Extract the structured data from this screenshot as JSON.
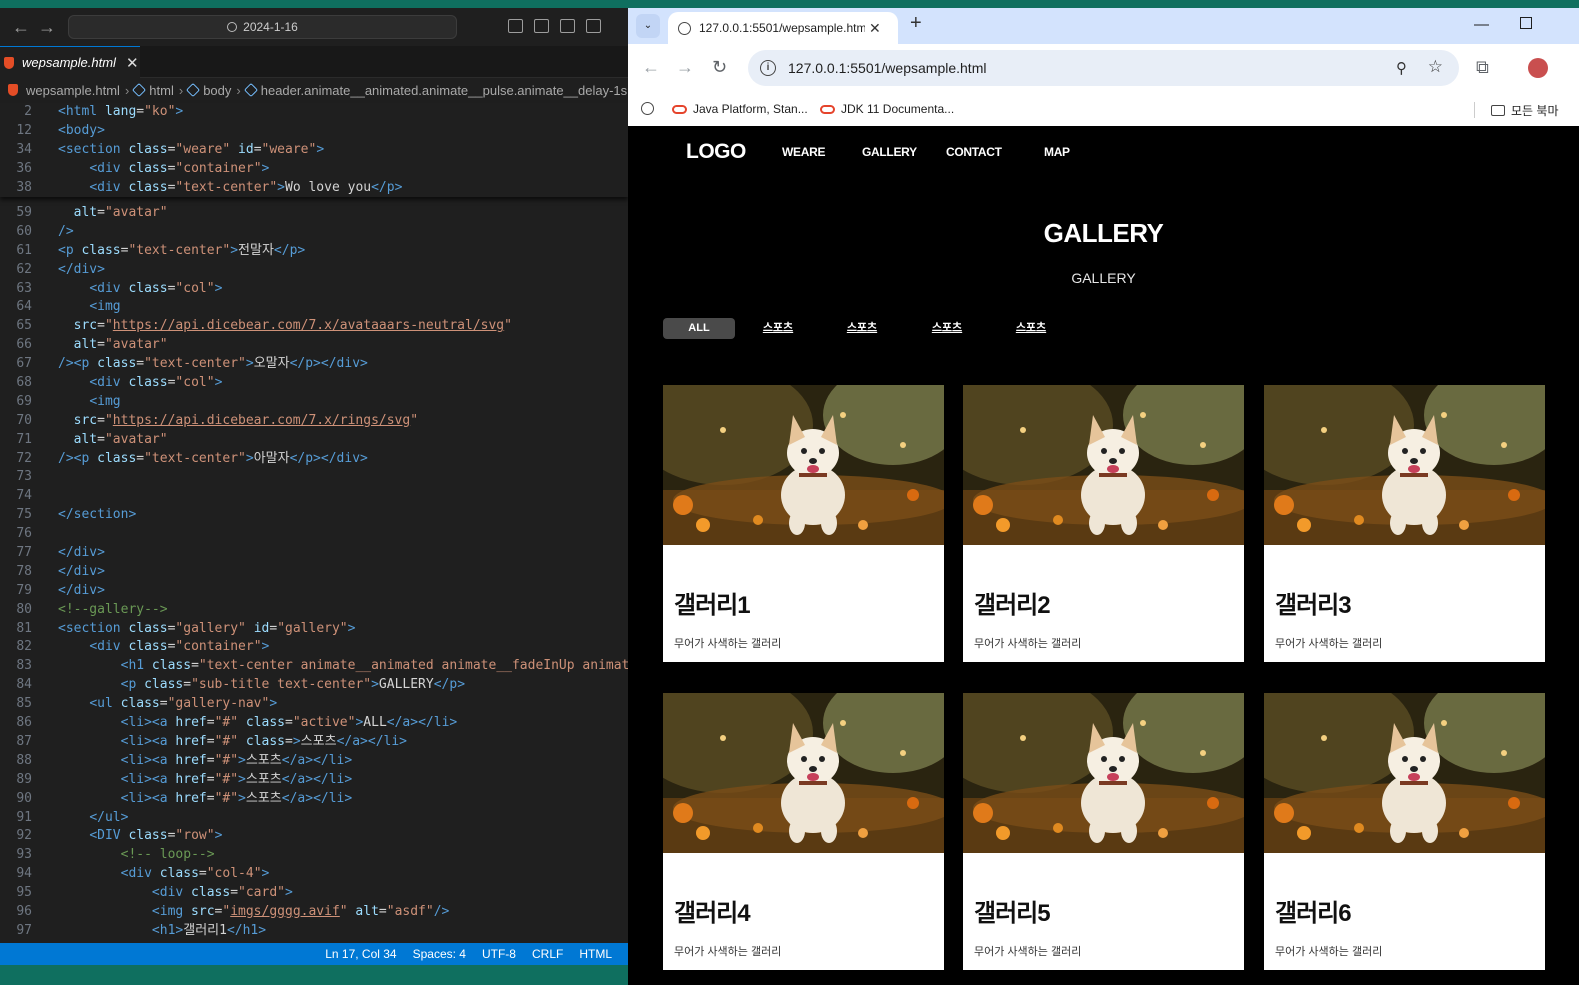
{
  "vscode": {
    "search_text": "2024-1-16",
    "tab_label": "wepsample.html",
    "breadcrumb": [
      "wepsample.html",
      "html",
      "body",
      "header.animate__animated.animate__pulse.animate__delay-1s"
    ],
    "status": {
      "position": "Ln 17, Col 34",
      "spaces": "Spaces: 4",
      "encoding": "UTF-8",
      "eol": "CRLF",
      "language": "HTML"
    }
  },
  "browser": {
    "tab_title": "127.0.0.1:5501/wepsample.htm",
    "url": "127.0.0.1:5501/wepsample.html",
    "bookmarks": [
      "Java Platform, Stan...",
      "JDK 11 Documenta..."
    ],
    "bookmarks_folder": "모든 북마"
  },
  "site": {
    "logo": "LOGO",
    "nav": [
      "WEARE",
      "GALLERY",
      "CONTACT",
      "MAP"
    ],
    "gallery_title": "GALLERY",
    "gallery_subtitle": "GALLERY",
    "filters": [
      "ALL",
      "스포츠",
      "스포츠",
      "스포츠",
      "스포츠"
    ],
    "cards": [
      {
        "title": "갤러리1",
        "desc": "무어가 사색하는 갤러리"
      },
      {
        "title": "갤러리2",
        "desc": "무어가 사색하는 갤러리"
      },
      {
        "title": "갤러리3",
        "desc": "무어가 사색하는 갤러리"
      },
      {
        "title": "갤러리4",
        "desc": "무어가 사색하는 갤러리"
      },
      {
        "title": "갤러리5",
        "desc": "무어가 사색하는 갤러리"
      },
      {
        "title": "갤러리6",
        "desc": "무어가 사색하는 갤러리"
      }
    ]
  },
  "code": {
    "sticky": [
      {
        "n": "2",
        "tokens": [
          [
            "t",
            "<html"
          ],
          [
            "a",
            " lang"
          ],
          [
            "w",
            "="
          ],
          [
            "s",
            "\"ko\""
          ],
          [
            "t",
            ">"
          ]
        ]
      },
      {
        "n": "12",
        "tokens": [
          [
            "t",
            "<body>"
          ]
        ]
      },
      {
        "n": "34",
        "tokens": [
          [
            "t",
            "<section"
          ],
          [
            "a",
            " class"
          ],
          [
            "w",
            "="
          ],
          [
            "s",
            "\"weare\""
          ],
          [
            "a",
            " id"
          ],
          [
            "w",
            "="
          ],
          [
            "s",
            "\"weare\""
          ],
          [
            "t",
            ">"
          ]
        ]
      },
      {
        "n": "36",
        "tokens": [
          [
            "w",
            "    "
          ],
          [
            "t",
            "<div"
          ],
          [
            "a",
            " class"
          ],
          [
            "w",
            "="
          ],
          [
            "s",
            "\"container\""
          ],
          [
            "t",
            ">"
          ]
        ]
      },
      {
        "n": "38",
        "tokens": [
          [
            "w",
            "    "
          ],
          [
            "t",
            "<div"
          ],
          [
            "a",
            " class"
          ],
          [
            "w",
            "="
          ],
          [
            "s",
            "\"text-center\""
          ],
          [
            "t",
            ">"
          ],
          [
            "w",
            "Wo love you"
          ],
          [
            "t",
            "</p>"
          ]
        ]
      }
    ],
    "lines": [
      {
        "n": "59",
        "tokens": [
          [
            "w",
            "  "
          ],
          [
            "a",
            "alt"
          ],
          [
            "w",
            "="
          ],
          [
            "s",
            "\"avatar\""
          ]
        ]
      },
      {
        "n": "60",
        "tokens": [
          [
            "t",
            "/>"
          ]
        ]
      },
      {
        "n": "61",
        "tokens": [
          [
            "t",
            "<p"
          ],
          [
            "a",
            " class"
          ],
          [
            "w",
            "="
          ],
          [
            "s",
            "\"text-center\""
          ],
          [
            "t",
            ">"
          ],
          [
            "w",
            "전말자"
          ],
          [
            "t",
            "</p>"
          ]
        ]
      },
      {
        "n": "62",
        "tokens": [
          [
            "t",
            "</div>"
          ]
        ]
      },
      {
        "n": "63",
        "tokens": [
          [
            "w",
            "    "
          ],
          [
            "t",
            "<div"
          ],
          [
            "a",
            " class"
          ],
          [
            "w",
            "="
          ],
          [
            "s",
            "\"col\""
          ],
          [
            "t",
            ">"
          ]
        ]
      },
      {
        "n": "64",
        "tokens": [
          [
            "w",
            "    "
          ],
          [
            "t",
            "<img"
          ]
        ]
      },
      {
        "n": "65",
        "tokens": [
          [
            "w",
            "  "
          ],
          [
            "a",
            "src"
          ],
          [
            "w",
            "="
          ],
          [
            "s",
            "\""
          ],
          [
            "u",
            "https://api.dicebear.com/7.x/avataaars-neutral/svg"
          ],
          [
            "s",
            "\""
          ]
        ]
      },
      {
        "n": "66",
        "tokens": [
          [
            "w",
            "  "
          ],
          [
            "a",
            "alt"
          ],
          [
            "w",
            "="
          ],
          [
            "s",
            "\"avatar\""
          ]
        ]
      },
      {
        "n": "67",
        "tokens": [
          [
            "t",
            "/><p"
          ],
          [
            "a",
            " class"
          ],
          [
            "w",
            "="
          ],
          [
            "s",
            "\"text-center\""
          ],
          [
            "t",
            ">"
          ],
          [
            "w",
            "오말자"
          ],
          [
            "t",
            "</p></div>"
          ]
        ]
      },
      {
        "n": "68",
        "tokens": [
          [
            "w",
            "    "
          ],
          [
            "t",
            "<div"
          ],
          [
            "a",
            " class"
          ],
          [
            "w",
            "="
          ],
          [
            "s",
            "\"col\""
          ],
          [
            "t",
            ">"
          ]
        ]
      },
      {
        "n": "69",
        "tokens": [
          [
            "w",
            "    "
          ],
          [
            "t",
            "<img"
          ]
        ]
      },
      {
        "n": "70",
        "tokens": [
          [
            "w",
            "  "
          ],
          [
            "a",
            "src"
          ],
          [
            "w",
            "="
          ],
          [
            "s",
            "\""
          ],
          [
            "u",
            "https://api.dicebear.com/7.x/rings/svg"
          ],
          [
            "s",
            "\""
          ]
        ]
      },
      {
        "n": "71",
        "tokens": [
          [
            "w",
            "  "
          ],
          [
            "a",
            "alt"
          ],
          [
            "w",
            "="
          ],
          [
            "s",
            "\"avatar\""
          ]
        ]
      },
      {
        "n": "72",
        "tokens": [
          [
            "t",
            "/><p"
          ],
          [
            "a",
            " class"
          ],
          [
            "w",
            "="
          ],
          [
            "s",
            "\"text-center\""
          ],
          [
            "t",
            ">"
          ],
          [
            "w",
            "아말자"
          ],
          [
            "t",
            "</p></div>"
          ]
        ]
      },
      {
        "n": "73",
        "tokens": []
      },
      {
        "n": "74",
        "tokens": []
      },
      {
        "n": "75",
        "tokens": [
          [
            "t",
            "</section>"
          ]
        ]
      },
      {
        "n": "76",
        "tokens": []
      },
      {
        "n": "77",
        "tokens": [
          [
            "t",
            "</div>"
          ]
        ]
      },
      {
        "n": "78",
        "tokens": [
          [
            "t",
            "</div>"
          ]
        ]
      },
      {
        "n": "79",
        "tokens": [
          [
            "t",
            "</div>"
          ]
        ]
      },
      {
        "n": "80",
        "tokens": [
          [
            "c",
            "<!--gallery-->"
          ]
        ]
      },
      {
        "n": "81",
        "tokens": [
          [
            "t",
            "<section"
          ],
          [
            "a",
            " class"
          ],
          [
            "w",
            "="
          ],
          [
            "s",
            "\"gallery\""
          ],
          [
            "a",
            " id"
          ],
          [
            "w",
            "="
          ],
          [
            "s",
            "\"gallery\""
          ],
          [
            "t",
            ">"
          ]
        ]
      },
      {
        "n": "82",
        "tokens": [
          [
            "w",
            "    "
          ],
          [
            "t",
            "<div"
          ],
          [
            "a",
            " class"
          ],
          [
            "w",
            "="
          ],
          [
            "s",
            "\"container\""
          ],
          [
            "t",
            ">"
          ]
        ]
      },
      {
        "n": "83",
        "tokens": [
          [
            "w",
            "        "
          ],
          [
            "t",
            "<h1"
          ],
          [
            "a",
            " class"
          ],
          [
            "w",
            "="
          ],
          [
            "s",
            "\"text-center animate__animated animate__fadeInUp animate_"
          ]
        ]
      },
      {
        "n": "84",
        "tokens": [
          [
            "w",
            "        "
          ],
          [
            "t",
            "<p"
          ],
          [
            "a",
            " class"
          ],
          [
            "w",
            "="
          ],
          [
            "s",
            "\"sub-title text-center\""
          ],
          [
            "t",
            ">"
          ],
          [
            "w",
            "GALLERY"
          ],
          [
            "t",
            "</p>"
          ]
        ]
      },
      {
        "n": "85",
        "tokens": [
          [
            "w",
            "    "
          ],
          [
            "t",
            "<ul"
          ],
          [
            "a",
            " class"
          ],
          [
            "w",
            "="
          ],
          [
            "s",
            "\"gallery-nav\""
          ],
          [
            "t",
            ">"
          ]
        ]
      },
      {
        "n": "86",
        "tokens": [
          [
            "w",
            "        "
          ],
          [
            "t",
            "<li><a"
          ],
          [
            "a",
            " href"
          ],
          [
            "w",
            "="
          ],
          [
            "s",
            "\"#\""
          ],
          [
            "a",
            " class"
          ],
          [
            "w",
            "="
          ],
          [
            "s",
            "\"active\""
          ],
          [
            "t",
            ">"
          ],
          [
            "w",
            "ALL"
          ],
          [
            "t",
            "</a></li>"
          ]
        ]
      },
      {
        "n": "87",
        "tokens": [
          [
            "w",
            "        "
          ],
          [
            "t",
            "<li><a"
          ],
          [
            "a",
            " href"
          ],
          [
            "w",
            "="
          ],
          [
            "s",
            "\"#\""
          ],
          [
            "a",
            " class"
          ],
          [
            "w",
            "="
          ],
          [
            "t",
            ">"
          ],
          [
            "w",
            "스포츠"
          ],
          [
            "t",
            "</a></li>"
          ]
        ]
      },
      {
        "n": "88",
        "tokens": [
          [
            "w",
            "        "
          ],
          [
            "t",
            "<li><a"
          ],
          [
            "a",
            " href"
          ],
          [
            "w",
            "="
          ],
          [
            "s",
            "\"#\""
          ],
          [
            "t",
            ">"
          ],
          [
            "w",
            "스포츠"
          ],
          [
            "t",
            "</a></li>"
          ]
        ]
      },
      {
        "n": "89",
        "tokens": [
          [
            "w",
            "        "
          ],
          [
            "t",
            "<li><a"
          ],
          [
            "a",
            " href"
          ],
          [
            "w",
            "="
          ],
          [
            "s",
            "\"#\""
          ],
          [
            "t",
            ">"
          ],
          [
            "w",
            "스포츠"
          ],
          [
            "t",
            "</a></li>"
          ]
        ]
      },
      {
        "n": "90",
        "tokens": [
          [
            "w",
            "        "
          ],
          [
            "t",
            "<li><a"
          ],
          [
            "a",
            " href"
          ],
          [
            "w",
            "="
          ],
          [
            "s",
            "\"#\""
          ],
          [
            "t",
            ">"
          ],
          [
            "w",
            "스포츠"
          ],
          [
            "t",
            "</a></li>"
          ]
        ]
      },
      {
        "n": "91",
        "tokens": [
          [
            "w",
            "    "
          ],
          [
            "t",
            "</ul>"
          ]
        ]
      },
      {
        "n": "92",
        "tokens": [
          [
            "w",
            "    "
          ],
          [
            "t",
            "<DIV"
          ],
          [
            "a",
            " class"
          ],
          [
            "w",
            "="
          ],
          [
            "s",
            "\"row\""
          ],
          [
            "t",
            ">"
          ]
        ]
      },
      {
        "n": "93",
        "tokens": [
          [
            "w",
            "        "
          ],
          [
            "c",
            "<!-- loop-->"
          ]
        ]
      },
      {
        "n": "94",
        "tokens": [
          [
            "w",
            "        "
          ],
          [
            "t",
            "<div"
          ],
          [
            "a",
            " class"
          ],
          [
            "w",
            "="
          ],
          [
            "s",
            "\"col-4\""
          ],
          [
            "t",
            ">"
          ]
        ]
      },
      {
        "n": "95",
        "tokens": [
          [
            "w",
            "            "
          ],
          [
            "t",
            "<div"
          ],
          [
            "a",
            " class"
          ],
          [
            "w",
            "="
          ],
          [
            "s",
            "\"card\""
          ],
          [
            "t",
            ">"
          ]
        ]
      },
      {
        "n": "96",
        "tokens": [
          [
            "w",
            "            "
          ],
          [
            "t",
            "<img"
          ],
          [
            "a",
            " src"
          ],
          [
            "w",
            "="
          ],
          [
            "s",
            "\""
          ],
          [
            "u",
            "imgs/gggg.avif"
          ],
          [
            "s",
            "\""
          ],
          [
            "a",
            " alt"
          ],
          [
            "w",
            "="
          ],
          [
            "s",
            "\"asdf\""
          ],
          [
            "t",
            "/>"
          ]
        ]
      },
      {
        "n": "97",
        "tokens": [
          [
            "w",
            "            "
          ],
          [
            "t",
            "<h1>"
          ],
          [
            "w",
            "갤러리1"
          ],
          [
            "t",
            "</h1>"
          ]
        ]
      }
    ]
  }
}
